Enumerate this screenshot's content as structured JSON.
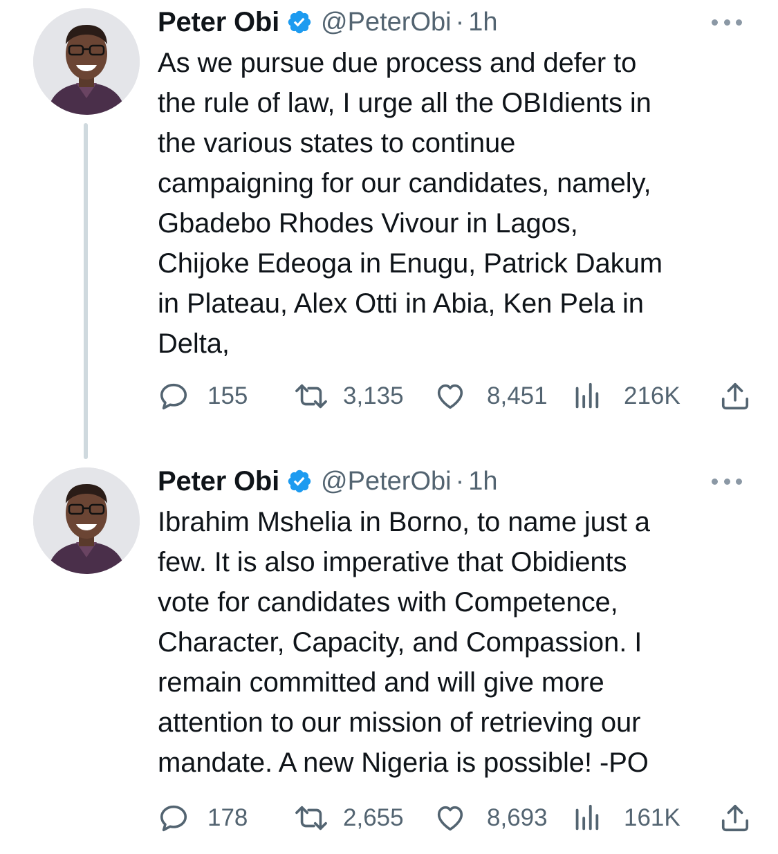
{
  "tweets": [
    {
      "author": {
        "display_name": "Peter Obi",
        "handle": "@PeterObi",
        "verified": true,
        "avatar_icon": "avatar-photo"
      },
      "separator": "·",
      "time": "1h",
      "text": "As we pursue due process and defer to\nthe rule of law, I urge all the OBIdients in\nthe various states to continue\ncampaigning for our candidates, namely,\nGbadebo Rhodes Vivour in Lagos,\nChijoke Edeoga in Enugu, Patrick Dakum\nin Plateau, Alex Otti in Abia, Ken Pela in\nDelta,",
      "stats": {
        "replies": "155",
        "retweets": "3,135",
        "likes": "8,451",
        "views": "216K"
      }
    },
    {
      "author": {
        "display_name": "Peter Obi",
        "handle": "@PeterObi",
        "verified": true,
        "avatar_icon": "avatar-photo"
      },
      "separator": "·",
      "time": "1h",
      "text": "Ibrahim Mshelia in Borno, to name just a\nfew. It is also imperative that Obidients\nvote for candidates with Competence,\nCharacter, Capacity, and Compassion. I\nremain committed and will give more\nattention to our mission of retrieving our\nmandate. A new Nigeria is possible! -PO",
      "stats": {
        "replies": "178",
        "retweets": "2,655",
        "likes": "8,693",
        "views": "161K"
      }
    }
  ],
  "icons": {
    "reply": "reply-icon",
    "retweet": "retweet-icon",
    "like": "heart-icon",
    "views": "views-icon",
    "share": "share-icon",
    "more": "more-icon",
    "verified": "verified-badge-icon"
  },
  "colors": {
    "text": "#0f1419",
    "muted": "#536471",
    "verified": "#1d9bf0",
    "thread_line": "#cfd9de"
  }
}
